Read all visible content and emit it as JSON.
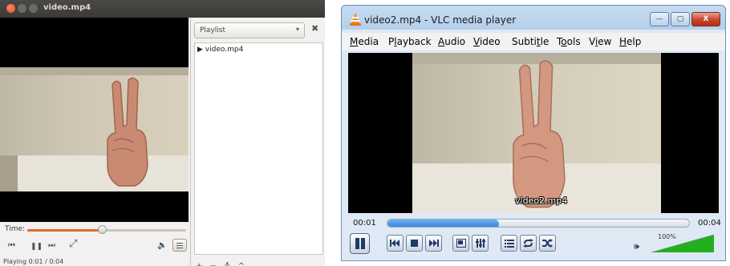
{
  "left_player": {
    "title": "video.mp4",
    "time_label": "Time:",
    "seek_fraction": 0.47,
    "status_text": "Playing   0:01 / 0:04",
    "playlist": {
      "combo_label": "Playlist",
      "combo_arrow": "▾",
      "close_glyph": "✖",
      "items": [
        "video.mp4"
      ],
      "item_marker": "▶",
      "toolbar_glyphs": "+ − ≛ ^ ⌄"
    },
    "controls": {
      "prev_glyph": "⏮",
      "pause_glyph": "❚❚",
      "next_glyph": "⏭",
      "fullscreen_glyph": "⤢",
      "volume_glyph": "🔈"
    }
  },
  "vlc_player": {
    "title": "video2.mp4 - VLC media player",
    "window_buttons": {
      "minimize": "—",
      "maximize": "▢",
      "close": "X"
    },
    "menu": [
      {
        "pre": "",
        "key": "M",
        "post": "edia"
      },
      {
        "pre": "P",
        "key": "l",
        "post": "ayback"
      },
      {
        "pre": "",
        "key": "A",
        "post": "udio"
      },
      {
        "pre": "",
        "key": "V",
        "post": "ideo"
      },
      {
        "pre": "Subti",
        "key": "t",
        "post": "le"
      },
      {
        "pre": "T",
        "key": "o",
        "post": "ols"
      },
      {
        "pre": "V",
        "key": "i",
        "post": "ew"
      },
      {
        "pre": "",
        "key": "H",
        "post": "elp"
      }
    ],
    "video_overlay_filename": "video2.mp4",
    "elapsed": "00:01",
    "total": "00:04",
    "seek_fraction": 0.37,
    "volume_percent": "100%",
    "volume_level": 1.0,
    "colors": {
      "seek_fill": "#2e7fd8",
      "volume_fill": "#22b020",
      "accent_orange": "#e56a2c"
    }
  }
}
